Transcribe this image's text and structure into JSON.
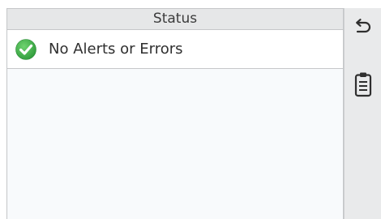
{
  "header": {
    "title": "Status"
  },
  "status": {
    "message": "No Alerts or Errors",
    "icon": "check-circle-icon",
    "icon_color": "#3fae49"
  },
  "sidebar": {
    "buttons": [
      {
        "icon": "back-arrow-icon"
      },
      {
        "icon": "clipboard-icon"
      }
    ]
  },
  "colors": {
    "header_bg": "#e6e7e8",
    "panel_bg": "#f8fafc",
    "sidebar_bg": "#e9eaeb",
    "border": "#c6c7c9"
  }
}
